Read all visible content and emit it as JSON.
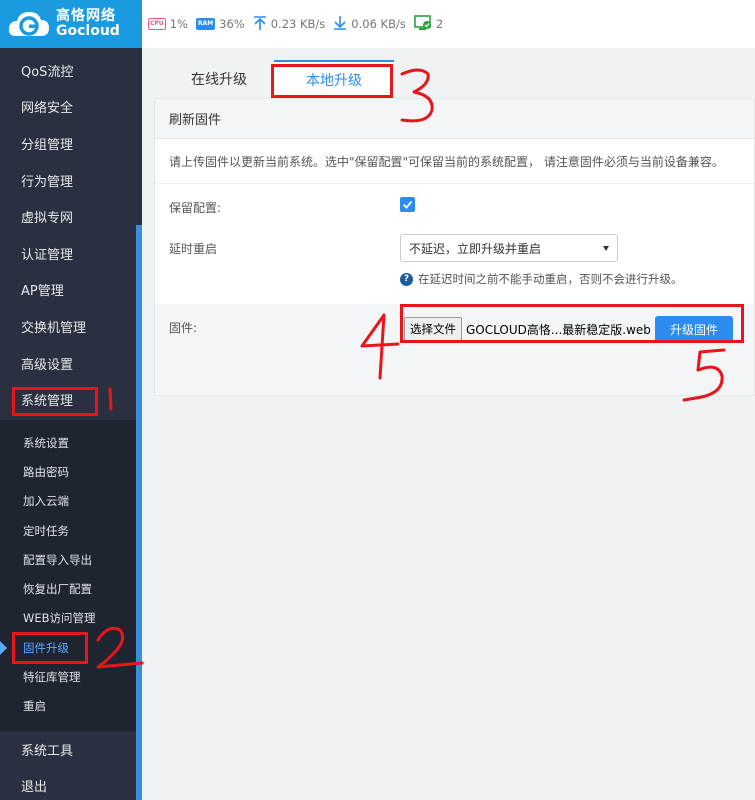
{
  "brand": {
    "name_cn": "高恪网络",
    "name_en": "Gocloud",
    "logo_letter": "G"
  },
  "topbar": {
    "cpu": {
      "chip": "CPU",
      "value": "1%",
      "icon": "cpu-icon"
    },
    "ram": {
      "chip": "RAM",
      "value": "36%",
      "icon": "ram-icon"
    },
    "upload": {
      "value": "0.23 KB/s",
      "icon": "upload-arrow-icon"
    },
    "download": {
      "value": "0.06 KB/s",
      "icon": "download-arrow-icon"
    },
    "devices": {
      "value": "2",
      "icon": "monitor-check-icon"
    }
  },
  "sidebar": {
    "items": [
      {
        "label": "QoS流控"
      },
      {
        "label": "网络安全"
      },
      {
        "label": "分组管理"
      },
      {
        "label": "行为管理"
      },
      {
        "label": "虚拟专网"
      },
      {
        "label": "认证管理"
      },
      {
        "label": "AP管理"
      },
      {
        "label": "交换机管理"
      },
      {
        "label": "高级设置"
      },
      {
        "label": "系统管理"
      }
    ],
    "sub_items": [
      {
        "label": "系统设置"
      },
      {
        "label": "路由密码"
      },
      {
        "label": "加入云端"
      },
      {
        "label": "定时任务"
      },
      {
        "label": "配置导入导出"
      },
      {
        "label": "恢复出厂配置"
      },
      {
        "label": "WEB访问管理"
      },
      {
        "label": "固件升级"
      },
      {
        "label": "特征库管理"
      },
      {
        "label": "重启"
      }
    ],
    "bottom_items": [
      {
        "label": "系统工具"
      },
      {
        "label": "退出"
      }
    ]
  },
  "tabs": [
    {
      "label": "在线升级"
    },
    {
      "label": "本地升级"
    }
  ],
  "panel": {
    "title": "刷新固件",
    "notice": "请上传固件以更新当前系统。选中\"保留配置\"可保留当前的系统配置， 请注意固件必须与当前设备兼容。",
    "keep_config_label": "保留配置:",
    "keep_config_checked": true,
    "delay_label": "延时重启",
    "delay_value": "不延迟，立即升级并重启",
    "delay_hint": "在延迟时间之前不能手动重启，否则不会进行升级。",
    "firmware_label": "固件:",
    "choose_file": "选择文件",
    "file_name": "GOCLOUD高恪...最新稳定版.web",
    "upgrade_button": "升级固件"
  },
  "annotations": [
    "1",
    "2",
    "3",
    "4",
    "5"
  ],
  "colors": {
    "accent": "#2d8cf0",
    "brand": "#1a9be0",
    "sidebar": "#2a3040",
    "annotation": "#e8161b"
  }
}
